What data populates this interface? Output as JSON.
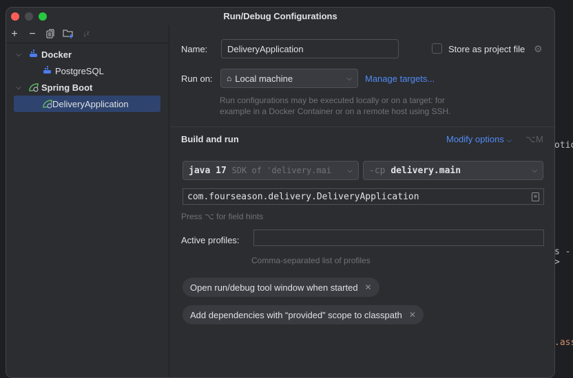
{
  "window": {
    "title": "Run/Debug Configurations"
  },
  "toolbar": {
    "add": "+",
    "remove": "−",
    "copy": "copy-icon",
    "new_folder": "folder-add-icon",
    "sort": "sort-alpha-icon"
  },
  "tree": [
    {
      "label": "Docker",
      "icon": "docker-icon",
      "bold": true
    },
    {
      "label": "PostgreSQL",
      "icon": "docker-icon"
    },
    {
      "label": "Spring Boot",
      "icon": "spring-boot-icon",
      "bold": true
    },
    {
      "label": "DeliveryApplication",
      "icon": "spring-boot-icon",
      "selected": true
    }
  ],
  "form": {
    "name_label": "Name:",
    "name_value": "DeliveryApplication",
    "store_label": "Store as project file",
    "store_checked": false,
    "run_on_label": "Run on:",
    "run_on_value": "Local machine",
    "manage_targets": "Manage targets...",
    "run_on_hint": "Run configurations may be executed locally or on a target: for example in a Docker Container or on a remote host using SSH.",
    "build_and_run": "Build and run",
    "modify_options": "Modify options",
    "modify_shortcut": "⌥M",
    "jdk_main": "java 17",
    "jdk_sub": "SDK of 'delivery.mai",
    "cp_prefix": "-cp",
    "cp_value": "delivery.main",
    "main_class": "com.fourseason.delivery.DeliveryApplication",
    "field_hints": "Press ⌥ for field hints",
    "profiles_label": "Active profiles:",
    "profiles_value": "",
    "profiles_hint": "Comma-separated list of profiles",
    "chips": [
      "Open run/debug tool window when started",
      "Add dependencies with “provided” scope to classpath"
    ]
  },
  "editor_fragments": [
    "otio",
    "s ->",
    ".ass"
  ],
  "colors": {
    "accent": "#548af7",
    "selection": "#2e436e",
    "close": "#ff5f57",
    "zoom": "#28c840",
    "docker": "#4c7cf2",
    "spring": "#5fb85f"
  }
}
